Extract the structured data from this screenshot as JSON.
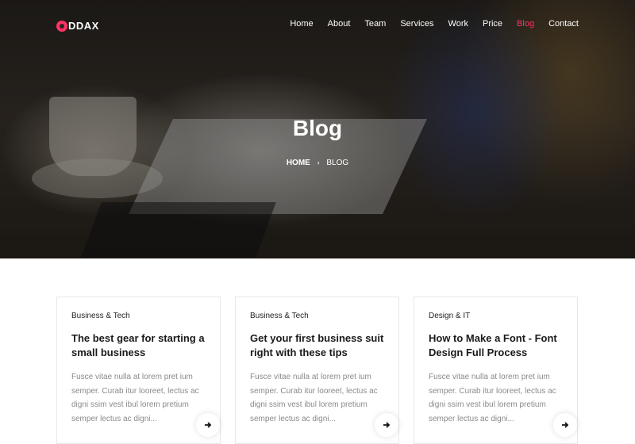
{
  "logo": {
    "text": "DDAX"
  },
  "nav": {
    "items": [
      {
        "label": "Home"
      },
      {
        "label": "About"
      },
      {
        "label": "Team"
      },
      {
        "label": "Services"
      },
      {
        "label": "Work"
      },
      {
        "label": "Price"
      },
      {
        "label": "Blog",
        "active": true
      },
      {
        "label": "Contact"
      }
    ]
  },
  "hero": {
    "title": "Blog",
    "breadcrumb": {
      "home": "HOME",
      "separator": "›",
      "current": "BLOG"
    }
  },
  "colors": {
    "accent": "#ff3366"
  },
  "posts": [
    {
      "category": "Business & Tech",
      "title": "The best gear for starting a small business",
      "excerpt": "Fusce vitae nulla at lorem pret ium semper. Curab itur looreet, lectus ac digni ssim vest ibul lorem pretium semper lectus ac digni...",
      "arrow_icon": "arrow-right-icon"
    },
    {
      "category": "Business & Tech",
      "title": "Get your first business suit right with these tips",
      "excerpt": "Fusce vitae nulla at lorem pret ium semper. Curab itur looreet, lectus ac digni ssim vest ibul lorem pretium semper lectus ac digni...",
      "arrow_icon": "arrow-right-icon"
    },
    {
      "category": "Design & IT",
      "title": "How to Make a Font - Font Design Full Process",
      "excerpt": "Fusce vitae nulla at lorem pret ium semper. Curab itur looreet, lectus ac digni ssim vest ibul lorem pretium semper lectus ac digni...",
      "arrow_icon": "arrow-right-icon"
    }
  ]
}
